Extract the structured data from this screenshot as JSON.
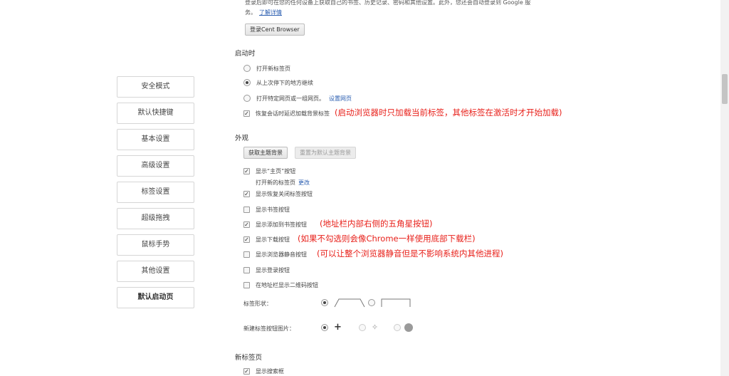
{
  "sidebar": {
    "items": [
      {
        "label": "安全模式"
      },
      {
        "label": "默认快捷键"
      },
      {
        "label": "基本设置"
      },
      {
        "label": "高级设置"
      },
      {
        "label": "标签设置"
      },
      {
        "label": "超级拖拽"
      },
      {
        "label": "鼠标手势"
      },
      {
        "label": "其他设置"
      },
      {
        "label": "默认启动页"
      }
    ],
    "active_index": 8
  },
  "signin": {
    "text_line1": "登录后即可在您的任何设备上获取自己的书签、历史记录、密码和其他设置。此外，您还会自动登录到 Google 服",
    "text_line2": "务。",
    "learn_more": "了解详情",
    "button": "登录Cent Browser"
  },
  "startup": {
    "title": "启动时",
    "options": [
      {
        "label": "打开新标签页",
        "selected": false
      },
      {
        "label": "从上次停下的地方继续",
        "selected": true
      },
      {
        "label": "打开特定网页或一组网页。",
        "selected": false,
        "link": "设置网页"
      }
    ],
    "lazy_load": {
      "label": "恢复会话时延迟加载背景标签",
      "checked": true
    }
  },
  "appearance": {
    "title": "外观",
    "get_theme_button": "获取主题背景",
    "reset_theme_button": "重置为默认主题背景",
    "home_button": {
      "label": "显示“主页”按钮",
      "checked": true
    },
    "home_sub": {
      "text": "打开新的标签页",
      "link": "更改"
    },
    "restore_closed": {
      "label": "显示恢复关闭标签按钮",
      "checked": true
    },
    "bookmark_button": {
      "label": "显示书签按钮",
      "checked": false
    },
    "add_bookmark": {
      "label": "显示添加到书签按钮",
      "checked": true
    },
    "download_button": {
      "label": "显示下载按钮",
      "checked": true
    },
    "mute_button": {
      "label": "显示浏览器静音按钮",
      "checked": false
    },
    "login_button": {
      "label": "显示登录按钮",
      "checked": false
    },
    "qr_code": {
      "label": "在地址栏显示二维码按钮",
      "checked": false
    },
    "tab_shape_label": "标签形状：",
    "new_tab_button_label": "新建标签按钮图片："
  },
  "newtab": {
    "title": "新标签页",
    "search_box": {
      "label": "显示搜索框",
      "checked": true
    }
  },
  "annotations": {
    "lazy_load_note": "(启动浏览器时只加载当前标签，其他标签在激活时才开始加载)",
    "add_bookmark_note": "(地址栏内部右侧的五角星按钮)",
    "download_note": "(如果不勾选则会像Chrome一样使用底部下载栏)",
    "mute_note": "(可以让整个浏览器静音但是不影响系统内其他进程)"
  },
  "colors": {
    "annotation": "#e8201a",
    "link": "#2a5db0"
  },
  "icons": {
    "check": "checkmark",
    "plus": "plus-icon"
  }
}
